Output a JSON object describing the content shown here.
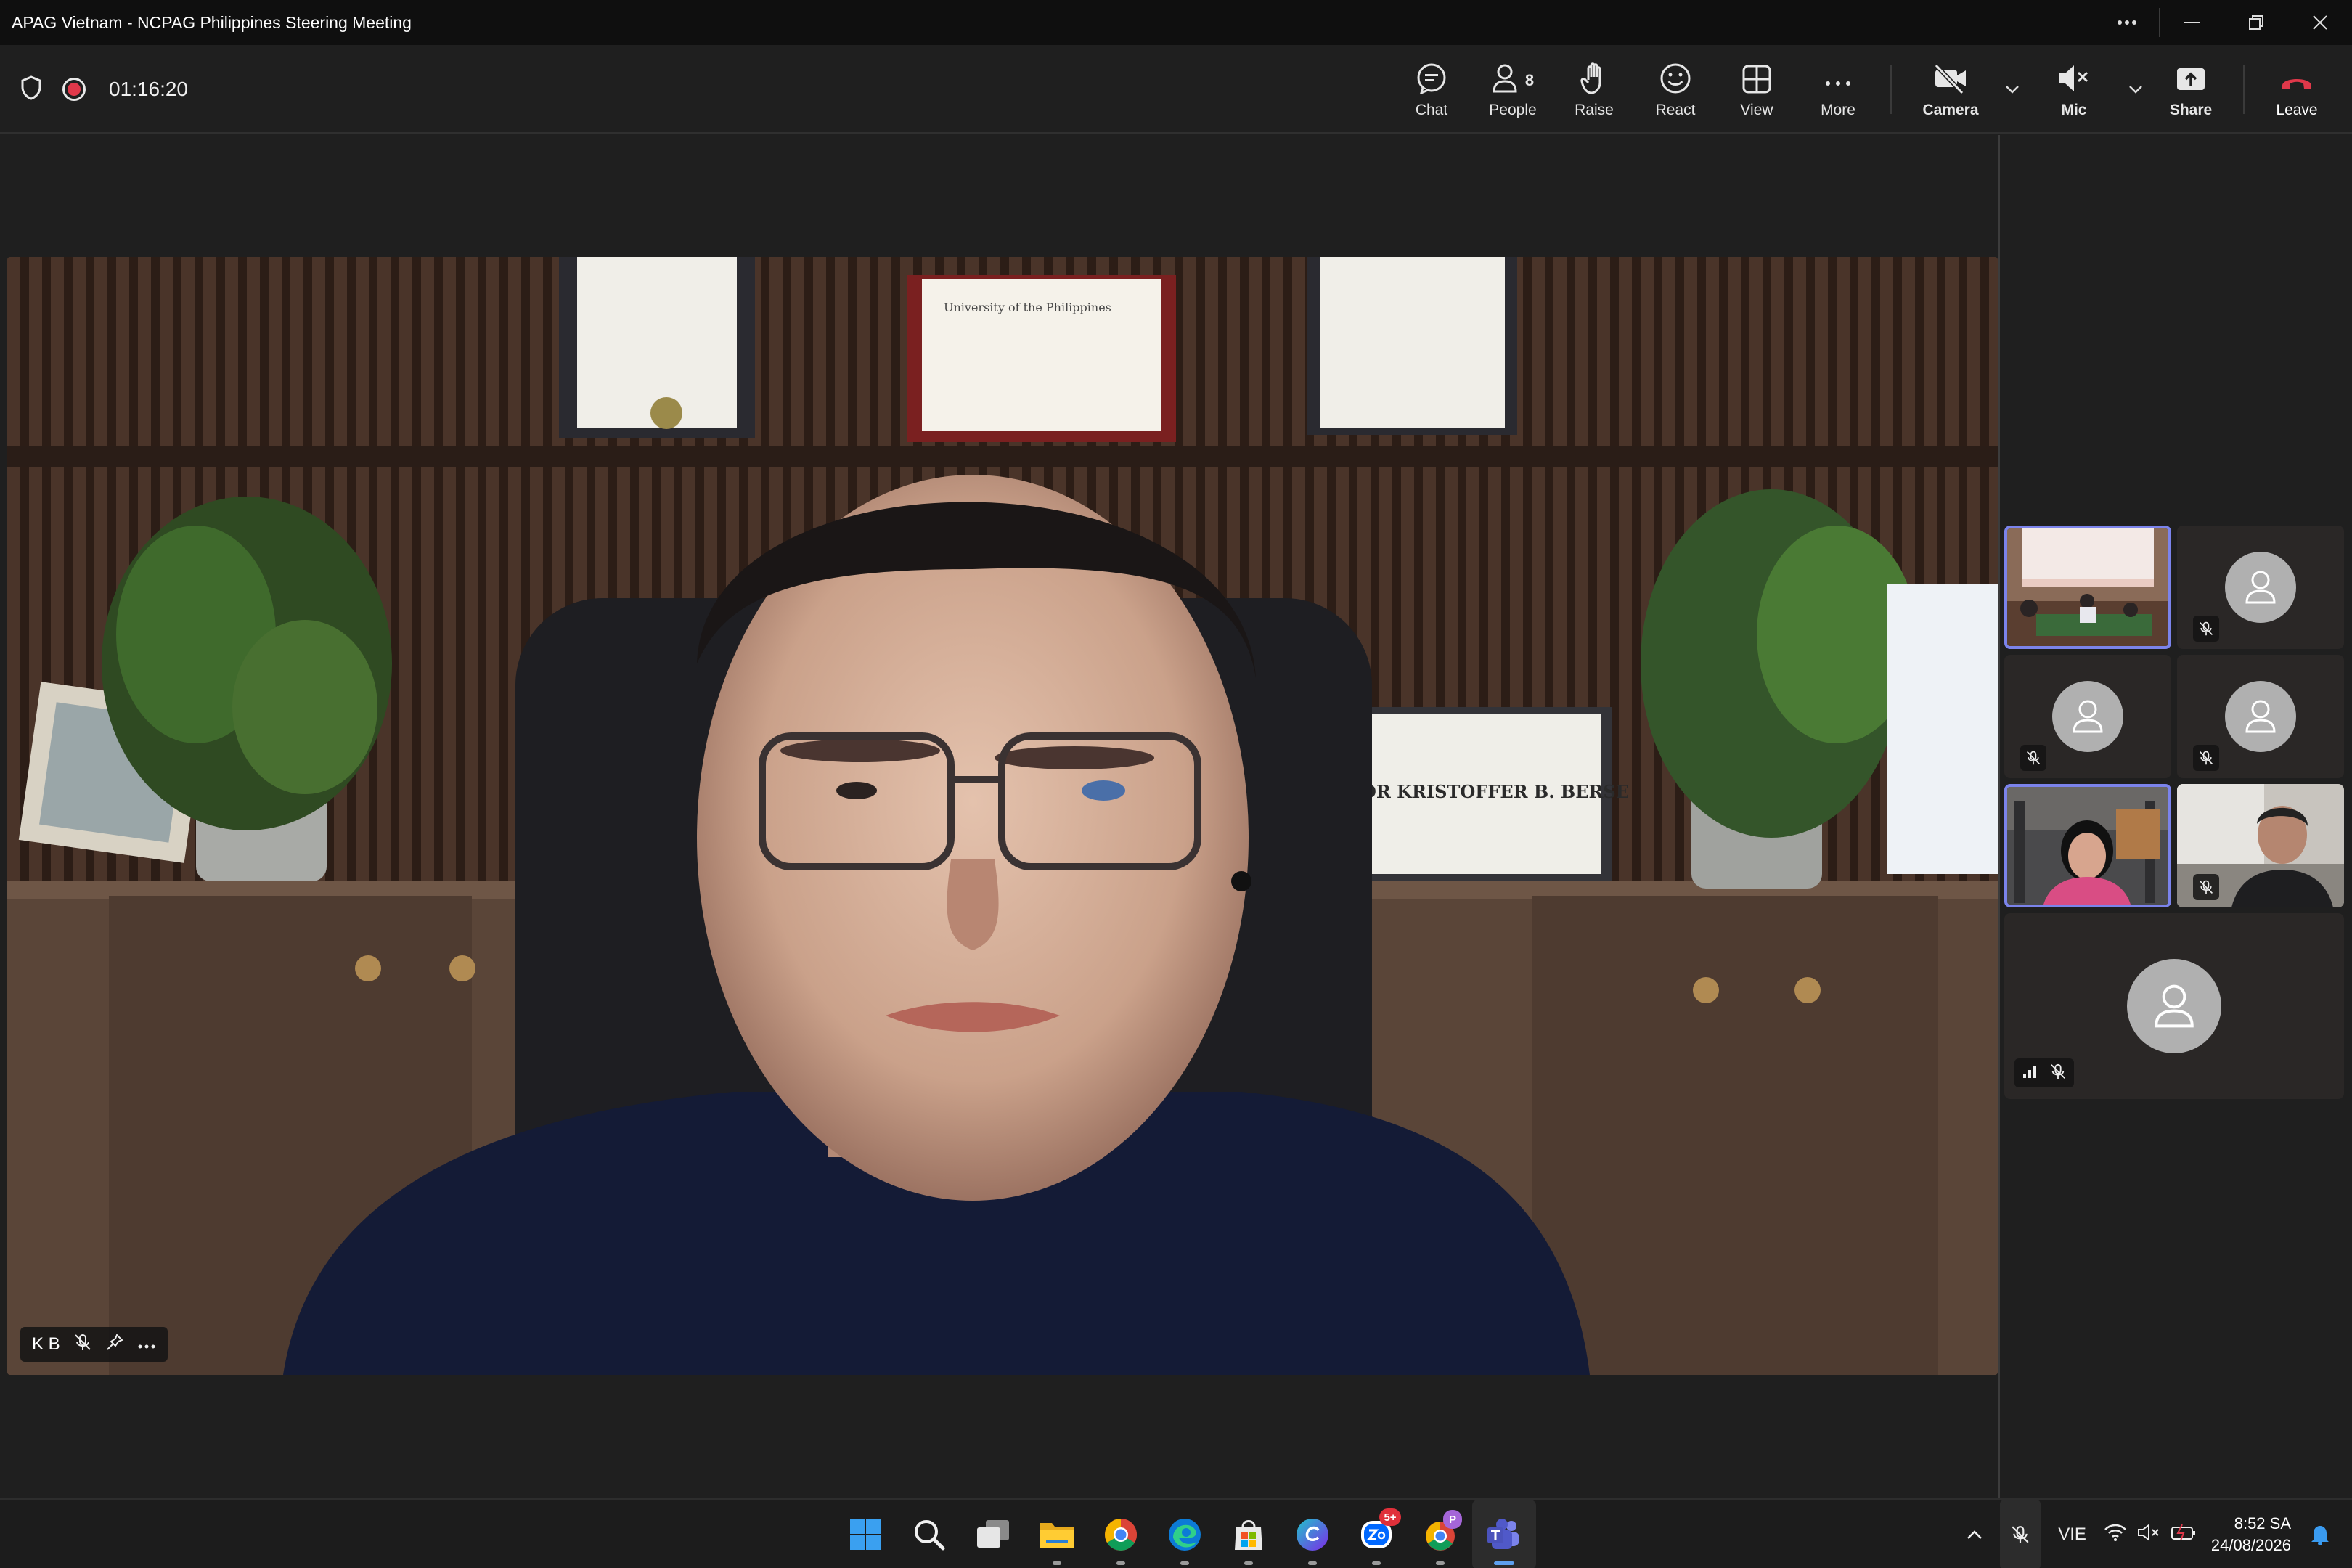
{
  "window": {
    "title": "APAG Vietnam - NCPAG Philippines Steering Meeting",
    "controls": [
      "more-icon",
      "minimize-icon",
      "restore-icon",
      "close-icon"
    ]
  },
  "toolbar": {
    "timer": "01:16:20",
    "recording": true,
    "buttons": {
      "chat": "Chat",
      "people": "People",
      "people_count": "8",
      "raise": "Raise",
      "react": "React",
      "view": "View",
      "more": "More",
      "camera": "Camera",
      "mic": "Mic",
      "share": "Share",
      "leave": "Leave"
    },
    "colors": {
      "leave": "#e0384a",
      "recording": "#e0384a"
    }
  },
  "main_video": {
    "name": "K B",
    "muted": true,
    "scene_text": {
      "nameplate": "DR KRISTOFFER B. BERSE",
      "certificate": "University of the Philippines"
    }
  },
  "gallery": {
    "active_color": "#7b83eb",
    "tiles": [
      {
        "kind": "video-room",
        "active": true,
        "muted": false
      },
      {
        "kind": "avatar",
        "active": false,
        "muted": true
      },
      {
        "kind": "avatar",
        "active": false,
        "muted": true
      },
      {
        "kind": "avatar",
        "active": false,
        "muted": true
      },
      {
        "kind": "video-woman",
        "active": true,
        "muted": false
      },
      {
        "kind": "video-man",
        "active": false,
        "muted": true
      },
      {
        "kind": "avatar",
        "active": false,
        "muted": true,
        "signal": true
      }
    ]
  },
  "taskbar": {
    "apps": [
      "windows-start",
      "search",
      "task-view",
      "file-explorer",
      "chrome",
      "edge",
      "microsoft-store",
      "canva",
      "zalo",
      "chrome-profile",
      "teams"
    ],
    "zalo_badge": "5+",
    "profile_badge": "P",
    "tray": {
      "language": "VIE",
      "time": "8:52 SA",
      "date": "24/08/2026"
    }
  }
}
